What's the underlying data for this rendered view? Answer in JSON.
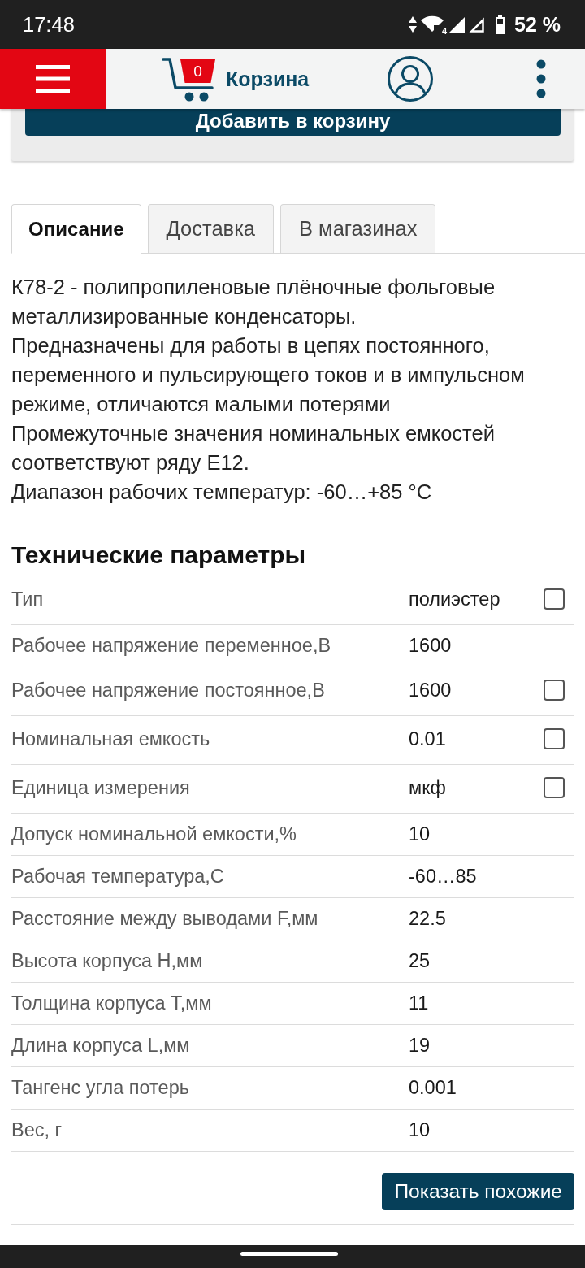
{
  "status_bar": {
    "time": "17:48",
    "wifi_label": "4",
    "battery": "52 %"
  },
  "header": {
    "cart_count": "0",
    "cart_label": "Корзина"
  },
  "product_card": {
    "add_to_cart": "Добавить в корзину"
  },
  "tabs": [
    {
      "label": "Описание",
      "selected": true
    },
    {
      "label": "Доставка",
      "selected": false
    },
    {
      "label": "В магазинах",
      "selected": false
    }
  ],
  "description": "К78-2 - полипропиленовые плёночные фольговые металлизированные конденсаторы.\nПредназначены для работы в цепях постоянного, переменного и пульсирующего токов и в импульсном режиме, отличаются малыми потерями\nПромежуточные значения номинальных емкостей соответствуют ряду Е12.\nДиапазон рабочих температур: -60…+85 °C",
  "specs": {
    "title": "Технические параметры",
    "rows": [
      {
        "name": "Тип",
        "value": "полиэстер",
        "checkbox": {
          "checked": false
        }
      },
      {
        "name": "Рабочее напряжение переменное,В",
        "value": "1600"
      },
      {
        "name": "Рабочее напряжение постоянное,В",
        "value": "1600",
        "checkbox": {
          "checked": false
        }
      },
      {
        "name": "Номинальная емкость",
        "value": "0.01",
        "checkbox": {
          "checked": false
        }
      },
      {
        "name": "Единица измерения",
        "value": "мкф",
        "checkbox": {
          "checked": false
        }
      },
      {
        "name": "Допуск номинальной емкости,%",
        "value": "10"
      },
      {
        "name": "Рабочая температура,С",
        "value": "-60…85"
      },
      {
        "name": "Расстояние между выводами F,мм",
        "value": "22.5"
      },
      {
        "name": "Высота корпуса H,мм",
        "value": "25"
      },
      {
        "name": "Толщина корпуса T,мм",
        "value": "11"
      },
      {
        "name": "Длина корпуса L,мм",
        "value": "19"
      },
      {
        "name": "Тангенс угла потерь",
        "value": "0.001"
      },
      {
        "name": "Вес, г",
        "value": "10"
      }
    ],
    "show_similar": "Показать похожие"
  }
}
